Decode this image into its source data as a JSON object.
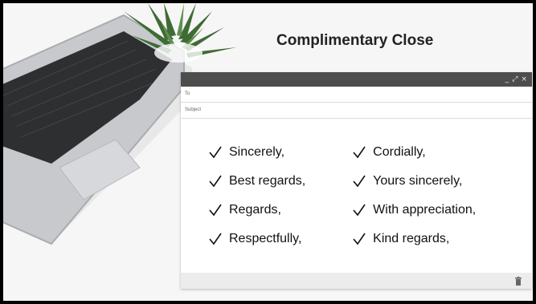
{
  "slide": {
    "title": "Complimentary Close"
  },
  "window": {
    "controls": {
      "minimize": "_",
      "expand": "⤢",
      "close": "×"
    },
    "to_label": "To",
    "subject_label": "Subject"
  },
  "closings": {
    "left": [
      "Sincerely,",
      "Best regards,",
      "Regards,",
      "Respectfully,"
    ],
    "right": [
      "Cordially,",
      "Yours sincerely,",
      "With appreciation,",
      "Kind regards,"
    ]
  },
  "icons": {
    "check": "check-icon",
    "trash": "trash-icon"
  },
  "colors": {
    "titlebar": "#4d4d4d",
    "footer": "#ececec",
    "text": "#111111"
  }
}
